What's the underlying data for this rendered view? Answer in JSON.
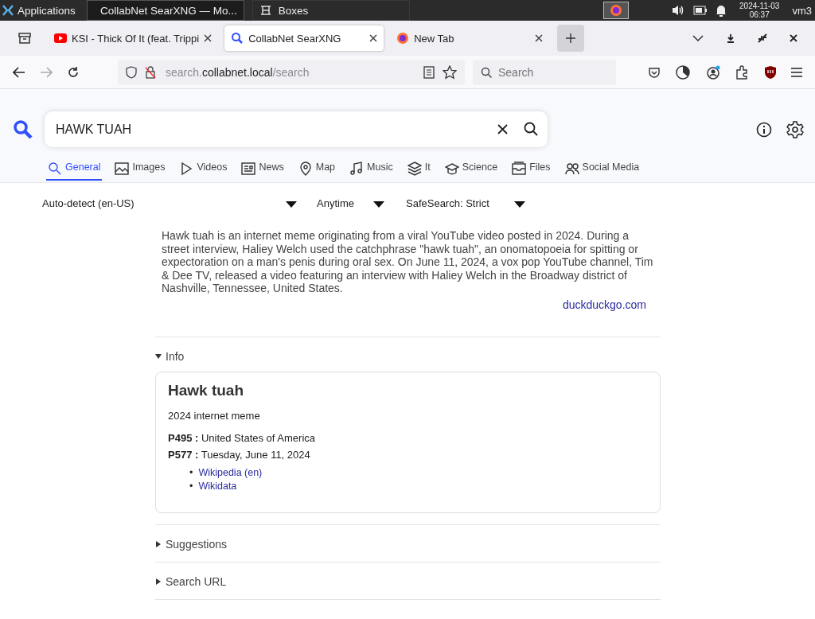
{
  "taskbar": {
    "menu_label": "Applications",
    "tasks": [
      {
        "label": "CollabNet SearXNG — Mo...",
        "kind": "browser",
        "selected": true
      },
      {
        "label": "Boxes",
        "kind": "boxes",
        "selected": false
      }
    ],
    "date": "2024-11-03",
    "time": "06:37",
    "user": "vm3"
  },
  "tabs": [
    {
      "label": "KSI - Thick Of It (feat. Trippi",
      "kind": "video",
      "selected": false
    },
    {
      "label": "CollabNet SearXNG",
      "kind": "search",
      "selected": true
    },
    {
      "label": "New Tab",
      "kind": "browser",
      "selected": false
    }
  ],
  "address_bar": {
    "url_parts": [
      {
        "text": "search.",
        "strong": false
      },
      {
        "text": "collabnet.local",
        "strong": true
      },
      {
        "text": "/search",
        "strong": false
      }
    ],
    "search_placeholder": "Search"
  },
  "search": {
    "value": "HAWK TUAH"
  },
  "categories": [
    {
      "label": "General",
      "selected": true
    },
    {
      "label": "Images",
      "selected": false
    },
    {
      "label": "Videos",
      "selected": false
    },
    {
      "label": "News",
      "selected": false
    },
    {
      "label": "Map",
      "selected": false
    },
    {
      "label": "Music",
      "selected": false
    },
    {
      "label": "It",
      "selected": false
    },
    {
      "label": "Science",
      "selected": false
    },
    {
      "label": "Files",
      "selected": false
    },
    {
      "label": "Social Media",
      "selected": false
    }
  ],
  "filters": [
    "Auto-detect (en-US)",
    "Anytime",
    "SafeSearch: Strict"
  ],
  "answer": {
    "text": "Hawk tuah is an internet meme originating from a viral YouTube video posted in 2024. During a street interview, Haliey Welch used the catchphrase \"hawk tuah\", an onomatopoeia for spitting or expectoration on a man's penis during oral sex. On June 11, 2024, a vox pop YouTube channel, Tim & Dee TV, released a video featuring an interview with Haliey Welch in the Broadway district of Nashville, Tennessee, United States.",
    "source": "duckduckgo.com"
  },
  "sections": [
    {
      "title": "Info",
      "expanded": true
    },
    {
      "title": "Suggestions",
      "expanded": false
    },
    {
      "title": "Search URL",
      "expanded": false
    }
  ],
  "infobox": {
    "title": "Hawk tuah",
    "subtitle": "2024 internet meme",
    "attributes": [
      {
        "key": "P495 :",
        "value": "United States of America"
      },
      {
        "key": "P577 :",
        "value": "Tuesday, June 11, 2024"
      }
    ],
    "bullet": "•",
    "links": [
      "Wikipedia (en)",
      "Wikidata"
    ]
  }
}
